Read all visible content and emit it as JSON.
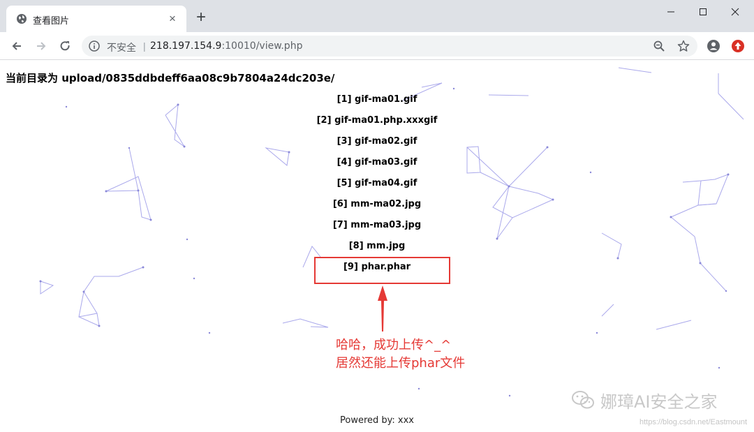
{
  "browser": {
    "tab_title": "查看图片",
    "tab_close": "×",
    "new_tab": "+",
    "security_label": "不安全",
    "url_host": "218.197.154.9",
    "url_rest": ":10010/view.php"
  },
  "page": {
    "directory_line": "当前目录为 upload/0835ddbdeff6aa08c9b7804a24dc203e/",
    "files": [
      "[1] gif-ma01.gif",
      "[2] gif-ma01.php.xxxgif",
      "[3] gif-ma02.gif",
      "[4] gif-ma03.gif",
      "[5] gif-ma04.gif",
      "[6] mm-ma02.jpg",
      "[7] mm-ma03.jpg",
      "[8] mm.jpg",
      "[9] phar.phar"
    ],
    "annotation_line1": "哈哈，成功上传^_^",
    "annotation_line2": "居然还能上传phar文件",
    "footer": "Powered by: xxx"
  },
  "watermark": {
    "text": "娜璋AI安全之家",
    "csdn": "https://blog.csdn.net/Eastmount"
  },
  "colors": {
    "annotation": "#e53935",
    "network_lines": "#9b99e8"
  }
}
